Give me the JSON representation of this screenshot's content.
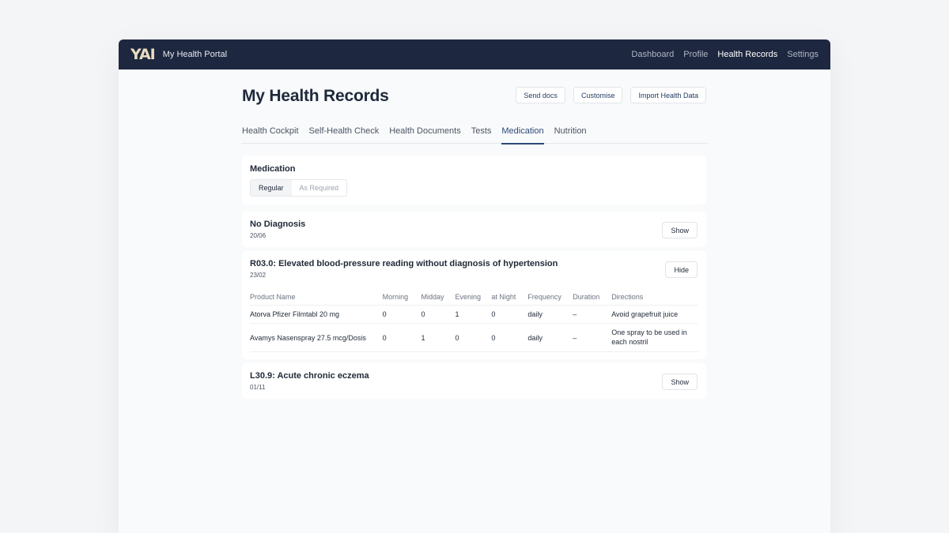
{
  "app": {
    "logo": "YAI",
    "name": "My Health Portal"
  },
  "nav": {
    "items": [
      "Dashboard",
      "Profile",
      "Health Records",
      "Settings"
    ],
    "active": "Health Records"
  },
  "page": {
    "title": "My Health Records",
    "actions": {
      "send_docs": "Send docs",
      "customise": "Customise",
      "import": "Import Health Data"
    }
  },
  "tabs": [
    "Health Cockpit",
    "Self-Health Check",
    "Health Documents",
    "Tests",
    "Medication",
    "Nutrition"
  ],
  "active_tab": "Medication",
  "medication": {
    "title": "Medication",
    "segments": [
      "Regular",
      "As Required"
    ],
    "active_segment": "Regular"
  },
  "diagnoses": [
    {
      "title": "No Diagnosis",
      "date": "20/06",
      "button": "Show"
    },
    {
      "title": "R03.0: Elevated blood-pressure reading without diagnosis of hypertension",
      "date": "23/02",
      "button": "Hide",
      "columns": [
        "Product Name",
        "Morning",
        "Midday",
        "Evening",
        "at Night",
        "Frequency",
        "Duration",
        "Directions"
      ],
      "rows": [
        [
          "Atorva Pfizer Filmtabl 20 mg",
          "0",
          "0",
          "1",
          "0",
          "daily",
          "–",
          "Avoid grapefruit juice"
        ],
        [
          "Avamys Nasenspray 27.5 mcg/Dosis",
          "0",
          "1",
          "0",
          "0",
          "daily",
          "–",
          "One spray to be used in each nostril"
        ]
      ]
    },
    {
      "title": "L30.9: Acute chronic eczema",
      "date": "01/11",
      "button": "Show"
    }
  ],
  "colors": {
    "topbar": "#1e2740",
    "accent": "#2c4a7a",
    "product_green": "#16a34a",
    "product_orange": "#f59e42"
  }
}
